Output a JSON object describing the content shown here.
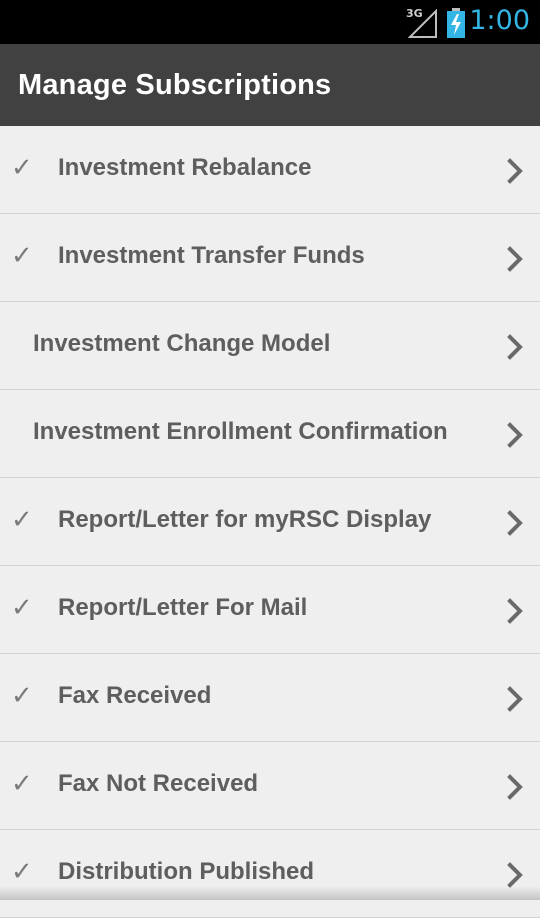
{
  "status_bar": {
    "network_label": "3G",
    "network_icon": "signal-icon",
    "battery_icon": "battery-charging-icon",
    "time": "1:00",
    "time_color": "#33b5e5"
  },
  "action_bar": {
    "title": "Manage Subscriptions",
    "background": "#414141"
  },
  "subscriptions": [
    {
      "label": "Investment Rebalance",
      "checked": true
    },
    {
      "label": "Investment Transfer Funds",
      "checked": true
    },
    {
      "label": "Investment Change Model",
      "checked": false
    },
    {
      "label": "Investment Enrollment Confirmation",
      "checked": false
    },
    {
      "label": "Report/Letter for myRSC Display",
      "checked": true
    },
    {
      "label": "Report/Letter For Mail",
      "checked": true
    },
    {
      "label": "Fax Received",
      "checked": true
    },
    {
      "label": "Fax Not Received",
      "checked": true
    },
    {
      "label": "Distribution Published",
      "checked": true
    }
  ],
  "icons": {
    "check": "✓",
    "chevron": "chevron-right-icon"
  }
}
